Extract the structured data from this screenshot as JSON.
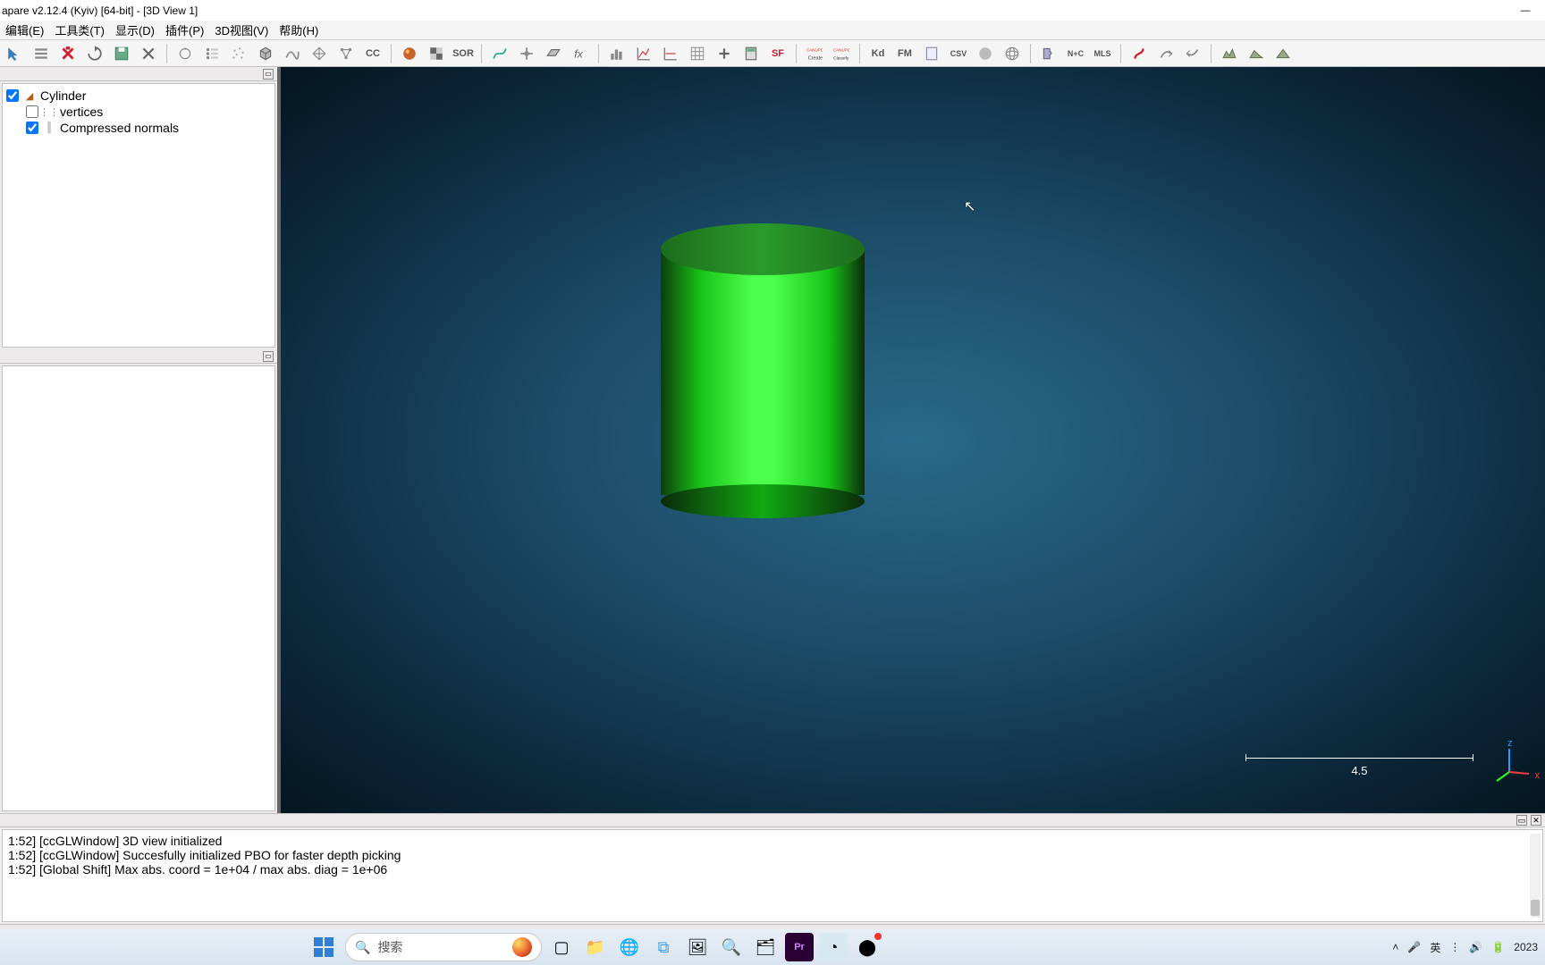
{
  "window": {
    "title": "apare v2.12.4 (Kyiv) [64-bit] - [3D View 1]"
  },
  "menu": {
    "items": [
      "编辑(E)",
      "工具类(T)",
      "显示(D)",
      "插件(P)",
      "3D视图(V)",
      "帮助(H)"
    ]
  },
  "toolbar": {
    "groups": [
      [
        "cursor-tool",
        "list-tool",
        "delete-tool",
        "reload-tool",
        "save-as-tool",
        "close-tool"
      ],
      [
        "pick-rotate",
        "point-list",
        "cloud",
        "cube",
        "curve",
        "wireframe",
        "graph",
        "cc-logo"
      ],
      [
        "color-ball",
        "checker",
        "sor"
      ],
      [
        "spline",
        "crosshair",
        "plane",
        "fx"
      ],
      [
        "histogram",
        "stats-up",
        "stats-flat",
        "grid",
        "plus",
        "calc",
        "sf"
      ],
      [
        "canupo-create",
        "canupo-classify"
      ],
      [
        "kd",
        "fm",
        "doc",
        "csv",
        "globe-solid",
        "globe-wire"
      ],
      [
        "puzzle",
        "nc",
        "mls"
      ],
      [
        "s-curve",
        "path-arrow",
        "return-arrow"
      ],
      [
        "terrain1",
        "terrain2",
        "terrain3"
      ]
    ],
    "text_icons": {
      "sor": "SOR",
      "cc": "CC",
      "sf": "SF",
      "kd": "Kd",
      "fm": "FM",
      "nc": "N+C",
      "mls": "MLS",
      "csv": "CSV"
    }
  },
  "tree": {
    "root": {
      "label": "Cylinder",
      "checked": true
    },
    "children": [
      {
        "id": "vertices",
        "label": "vertices",
        "checked": false
      },
      {
        "id": "normals",
        "label": "Compressed normals",
        "checked": true
      }
    ]
  },
  "viewport": {
    "scale_value": "4.5",
    "axis_z": "z",
    "axis_x": "x"
  },
  "console": {
    "lines": [
      "1:52] [ccGLWindow] 3D view initialized",
      "1:52] [ccGLWindow] Succesfully initialized PBO for faster depth picking",
      "1:52] [Global Shift] Max abs. coord = 1e+04 / max abs. diag = 1e+06"
    ]
  },
  "taskbar": {
    "search_placeholder": "搜索",
    "ime": "英",
    "year": "2023"
  }
}
